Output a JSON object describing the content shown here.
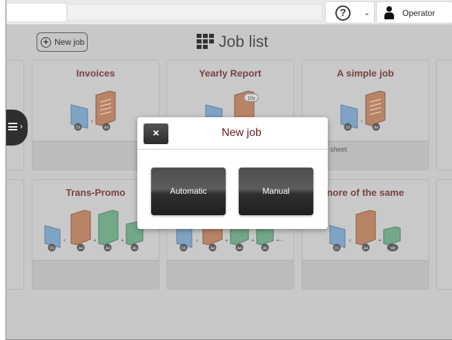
{
  "header": {
    "help_icon": "question-circle-icon",
    "user_label": "Operator",
    "user_icon": "user-icon"
  },
  "toolbar": {
    "new_job_label": "New job",
    "page_title": "Job list"
  },
  "jobs_row1": [
    {
      "title": "Invoices",
      "desc": ""
    },
    {
      "title": "Yearly Report",
      "desc": ""
    },
    {
      "title": "A simple job",
      "desc": "ist one sheet"
    }
  ],
  "jobs_row2": [
    {
      "title": "Trans-Promo",
      "desc": ""
    },
    {
      "title": "",
      "desc": ""
    },
    {
      "title": "nore of the same",
      "desc": ""
    }
  ],
  "art_labels": {
    "c5": "C5",
    "a4": "A4",
    "a5": "A5",
    "x10": "10x",
    "n100": "100"
  },
  "modal": {
    "title": "New job",
    "close_label": "×",
    "automatic_label": "Automatic",
    "manual_label": "Manual"
  },
  "colors": {
    "overlay_bg": "#c8c8c8",
    "title_red": "#6d1a1a",
    "envelope_blue": "#3f7fbf",
    "doc_orange": "#c0633a",
    "doc_green": "#3e9b5a"
  }
}
